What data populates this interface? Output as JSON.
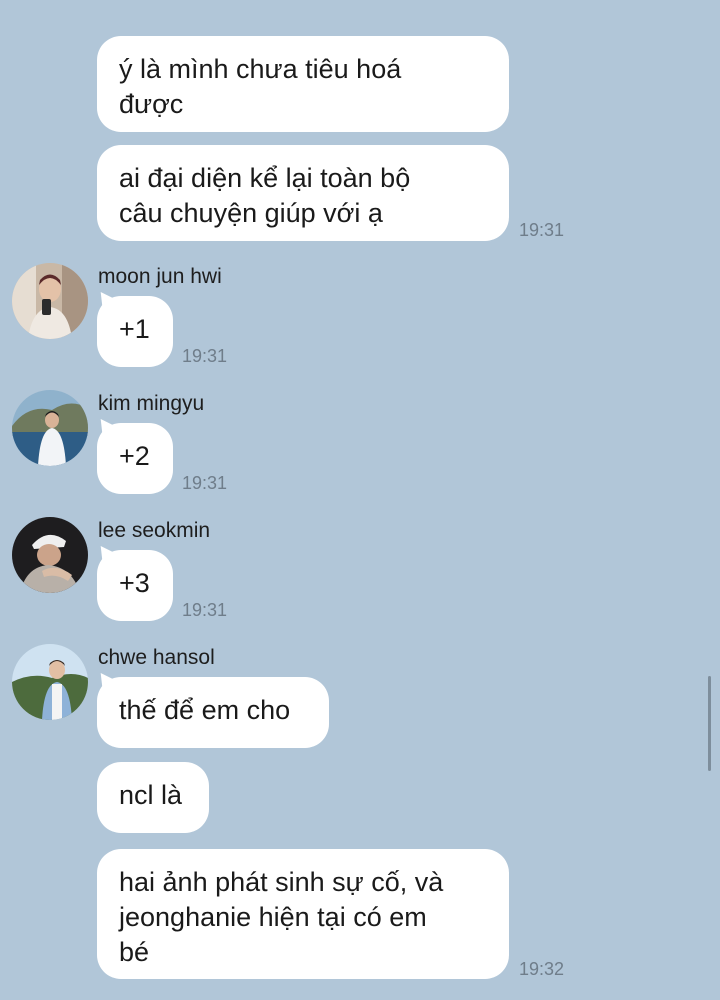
{
  "chat": {
    "messages": [
      {
        "text": "ý là mình chưa tiêu hoá\nđược"
      },
      {
        "text": "ai đại diện kể lại toàn bộ\ncâu chuyện giúp với ạ",
        "time": "19:31"
      },
      {
        "sender": "moon jun hwi",
        "text": "+1",
        "time": "19:31"
      },
      {
        "sender": "kim mingyu",
        "text": "+2",
        "time": "19:31"
      },
      {
        "sender": "lee seokmin",
        "text": "+3",
        "time": "19:31"
      },
      {
        "sender": "chwe hansol",
        "text": "thế để em cho"
      },
      {
        "text": "ncl là"
      },
      {
        "text": "hai ảnh phát sinh sự cố, và\njeonghanie hiện tại có em\nbé",
        "time": "19:32"
      }
    ]
  }
}
